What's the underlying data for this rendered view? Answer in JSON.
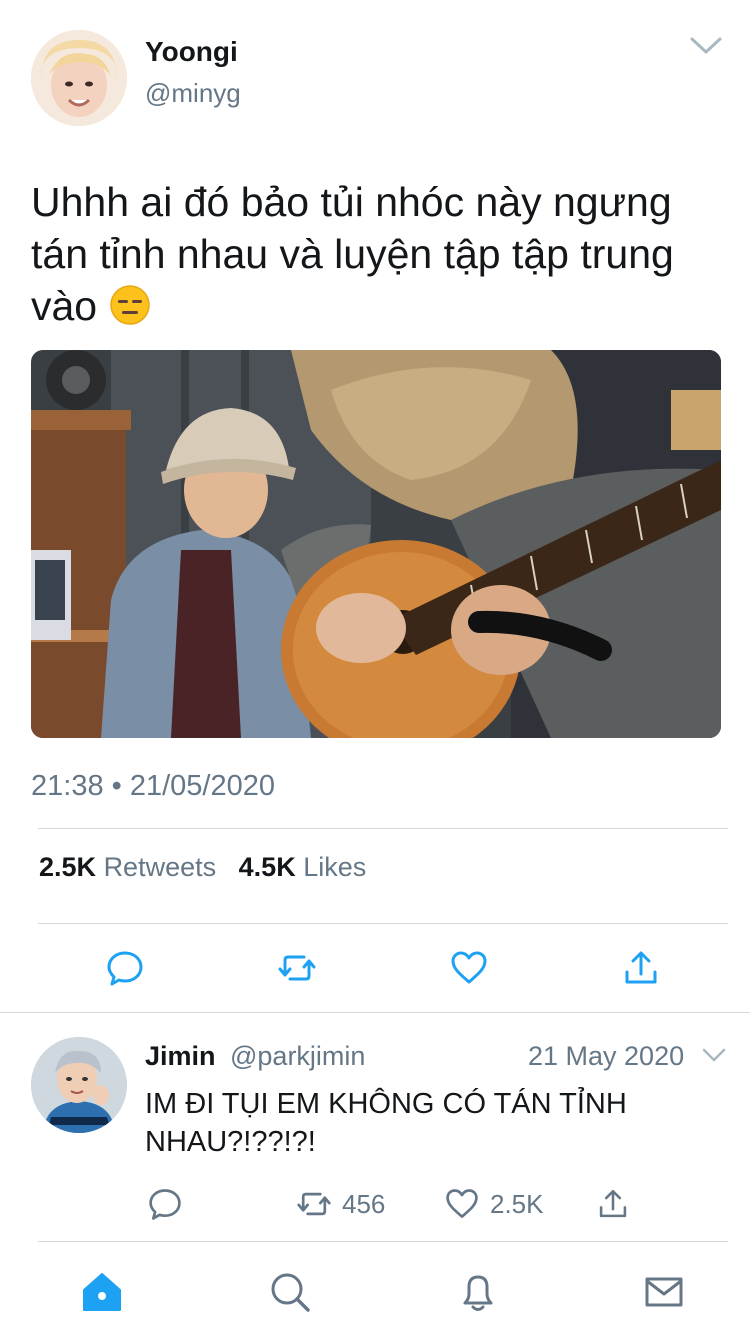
{
  "tweet": {
    "author_name": "Yoongi",
    "author_handle": "@minyg",
    "text": "Uhhh ai đó bảo tủi nhóc này ngưng tán tỉnh nhau và luyện tập tập trung vào",
    "emoji": "expressionless-face",
    "timestamp": "21:38 • 21/05/2020",
    "retweets_count": "2.5K",
    "retweets_label": "Retweets",
    "likes_count": "4.5K",
    "likes_label": "Likes",
    "actions": [
      "reply-icon",
      "retweet-icon",
      "like-icon",
      "share-icon"
    ]
  },
  "reply": {
    "author_name": "Jimin",
    "author_handle": "@parkjimin",
    "date": "21 May 2020",
    "text": "IM ĐI TỤI EM KHÔNG CÓ TÁN TỈNH NHAU?!??!?!",
    "retweet_count": "456",
    "like_count": "2.5K"
  },
  "tabbar": {
    "items": [
      "home-icon",
      "search-icon",
      "notifications-icon",
      "messages-icon"
    ],
    "active": "home-icon"
  },
  "colors": {
    "accent": "#1da1f2",
    "text_primary": "#14171a",
    "text_secondary": "#657786",
    "divider": "#d4d9de"
  }
}
